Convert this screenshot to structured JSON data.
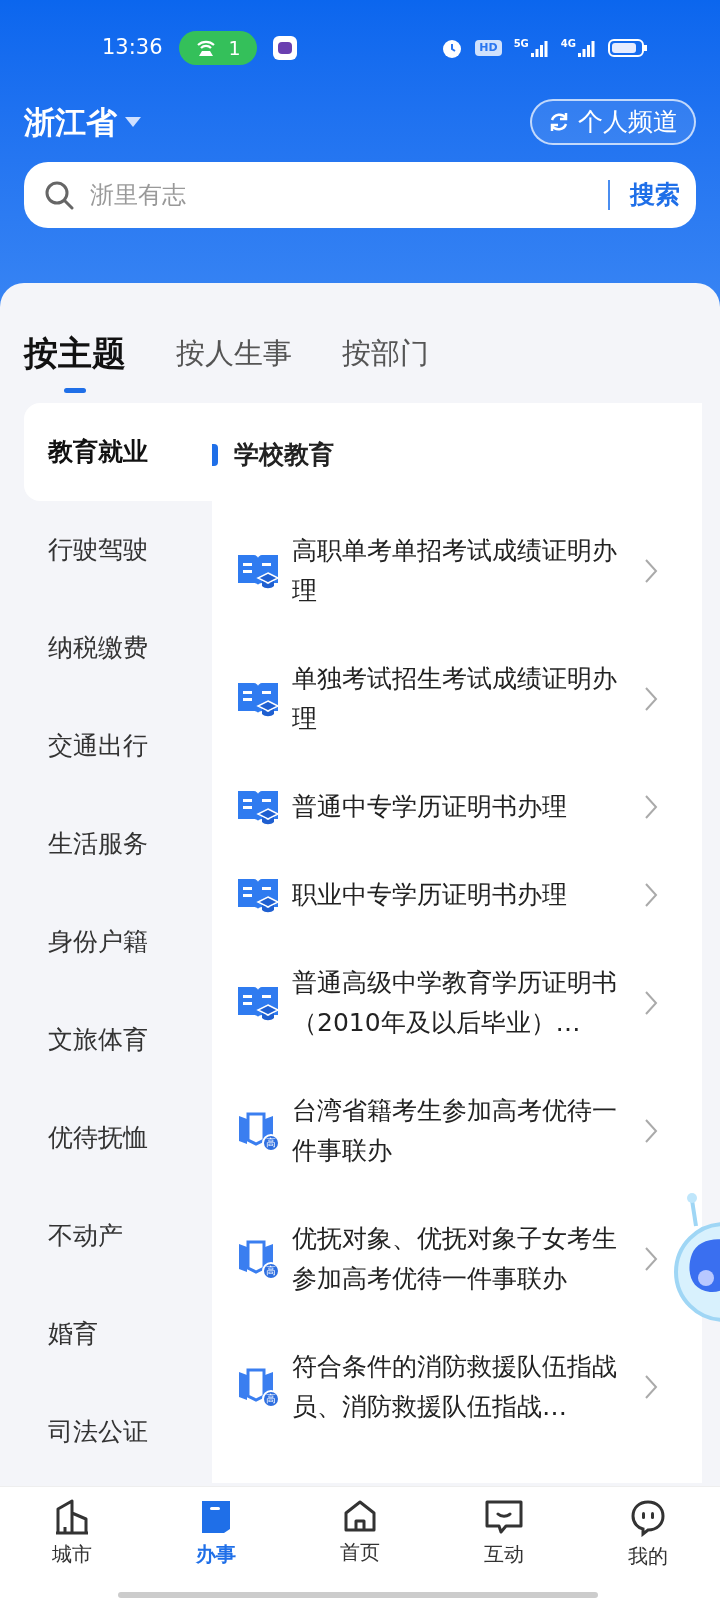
{
  "status_bar": {
    "time": "13:36",
    "hotspot_count": "1",
    "hd_label": "HD",
    "network_labels": [
      "5G",
      "4G"
    ]
  },
  "header": {
    "province": "浙江省",
    "channel_button": "个人频道"
  },
  "search": {
    "placeholder": "浙里有志",
    "button": "搜索"
  },
  "tabs": [
    {
      "label": "按主题",
      "selected": true
    },
    {
      "label": "按人生事",
      "selected": false
    },
    {
      "label": "按部门",
      "selected": false
    }
  ],
  "sidebar": {
    "items": [
      {
        "label": "教育就业",
        "selected": true
      },
      {
        "label": "行驶驾驶",
        "selected": false
      },
      {
        "label": "纳税缴费",
        "selected": false
      },
      {
        "label": "交通出行",
        "selected": false
      },
      {
        "label": "生活服务",
        "selected": false
      },
      {
        "label": "身份户籍",
        "selected": false
      },
      {
        "label": "文旅体育",
        "selected": false
      },
      {
        "label": "优待抚恤",
        "selected": false
      },
      {
        "label": "不动产",
        "selected": false
      },
      {
        "label": "婚育",
        "selected": false
      },
      {
        "label": "司法公证",
        "selected": false
      }
    ]
  },
  "section": {
    "title": "学校教育",
    "items": [
      {
        "kind": "book",
        "label": "高职单考单招考试成绩证明办理"
      },
      {
        "kind": "book",
        "label": "单独考试招生考试成绩证明办理"
      },
      {
        "kind": "book",
        "label": "普通中专学历证明书办理"
      },
      {
        "kind": "book",
        "label": "职业中专学历证明书办理"
      },
      {
        "kind": "book",
        "label": "普通高级中学教育学历证明书（2010年及以后毕业）…"
      },
      {
        "kind": "gaokao",
        "label": "台湾省籍考生参加高考优待一件事联办",
        "badge": "高"
      },
      {
        "kind": "gaokao",
        "label": "优抚对象、优抚对象子女考生参加高考优待一件事联办",
        "badge": "高"
      },
      {
        "kind": "gaokao",
        "label": "符合条件的消防救援队伍指战员、消防救援队伍指战…",
        "badge": "高"
      }
    ]
  },
  "bottom_nav": [
    {
      "label": "城市",
      "kind": "city",
      "selected": false
    },
    {
      "label": "办事",
      "kind": "tasks",
      "selected": true
    },
    {
      "label": "首页",
      "kind": "home",
      "selected": false
    },
    {
      "label": "互动",
      "kind": "chat",
      "selected": false
    },
    {
      "label": "我的",
      "kind": "me",
      "selected": false
    }
  ]
}
